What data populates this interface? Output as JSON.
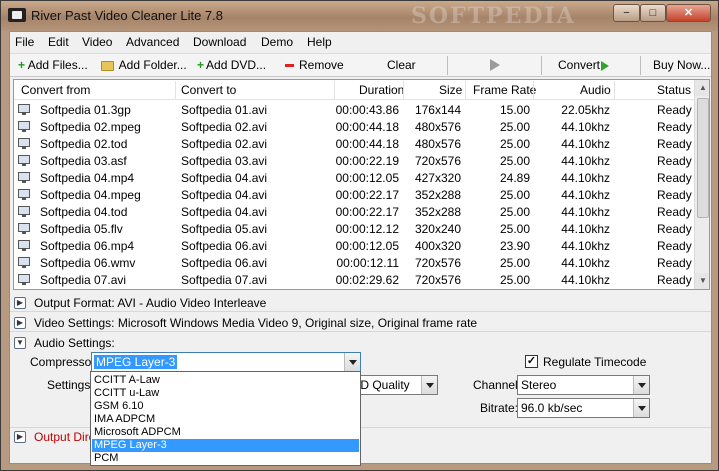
{
  "window": {
    "title": "River Past Video Cleaner Lite 7.8",
    "watermark": "SOFTPEDIA",
    "min": "−",
    "max": "□",
    "close": "✕"
  },
  "menu": [
    "File",
    "Edit",
    "Video",
    "Advanced",
    "Download",
    "Demo",
    "Help"
  ],
  "toolbar": {
    "add_files": "Add Files...",
    "add_folder": "Add Folder...",
    "add_dvd": "Add DVD...",
    "remove": "Remove",
    "clear": "Clear",
    "convert": "Convert",
    "buy_now": "Buy Now..."
  },
  "list": {
    "columns": [
      "Convert from",
      "Convert to",
      "Duration",
      "Size",
      "Frame Rate",
      "Audio",
      "Status"
    ],
    "rows": [
      [
        "Softpedia 01.3gp",
        "Softpedia 01.avi",
        "00:00:43.86",
        "176x144",
        "15.00",
        "22.05khz",
        "Ready"
      ],
      [
        "Softpedia 02.mpeg",
        "Softpedia 02.avi",
        "00:00:44.18",
        "480x576",
        "25.00",
        "44.10khz",
        "Ready"
      ],
      [
        "Softpedia 02.tod",
        "Softpedia 02.avi",
        "00:00:44.18",
        "480x576",
        "25.00",
        "44.10khz",
        "Ready"
      ],
      [
        "Softpedia 03.asf",
        "Softpedia 03.avi",
        "00:00:22.19",
        "720x576",
        "25.00",
        "44.10khz",
        "Ready"
      ],
      [
        "Softpedia 04.mp4",
        "Softpedia 04.avi",
        "00:00:12.05",
        "427x320",
        "24.89",
        "44.10khz",
        "Ready"
      ],
      [
        "Softpedia 04.mpeg",
        "Softpedia 04.avi",
        "00:00:22.17",
        "352x288",
        "25.00",
        "44.10khz",
        "Ready"
      ],
      [
        "Softpedia 04.tod",
        "Softpedia 04.avi",
        "00:00:22.17",
        "352x288",
        "25.00",
        "44.10khz",
        "Ready"
      ],
      [
        "Softpedia 05.flv",
        "Softpedia 05.avi",
        "00:00:12.12",
        "320x240",
        "25.00",
        "44.10khz",
        "Ready"
      ],
      [
        "Softpedia 06.mp4",
        "Softpedia 06.avi",
        "00:00:12.05",
        "400x320",
        "23.90",
        "44.10khz",
        "Ready"
      ],
      [
        "Softpedia 06.wmv",
        "Softpedia 06.avi",
        "00:00:12.11",
        "720x576",
        "25.00",
        "44.10khz",
        "Ready"
      ],
      [
        "Softpedia 07.avi",
        "Softpedia 07.avi",
        "00:02:29.62",
        "720x576",
        "25.00",
        "44.10khz",
        "Ready"
      ]
    ]
  },
  "panels": {
    "output_format": "Output Format: AVI - Audio Video Interleave",
    "video_settings": "Video Settings: Microsoft Windows Media Video 9, Original size, Original frame rate",
    "audio_settings": "Audio Settings:",
    "output_dir": "Output Dire"
  },
  "audio": {
    "compressor_label": "Compressor:",
    "compressor_value": "MPEG Layer-3",
    "settings_label": "Settings:",
    "settings_value": "/D Quality",
    "regulate_label": "Regulate Timecode",
    "regulate_checked": "✓",
    "channel_label": "Channel:",
    "channel_value": "Stereo",
    "bitrate_label": "Bitrate:",
    "bitrate_value": "96.0 kb/sec"
  },
  "dropdown": {
    "items": [
      "CCITT A-Law",
      "CCITT u-Law",
      "GSM 6.10",
      "IMA ADPCM",
      "Microsoft ADPCM",
      "MPEG Layer-3",
      "PCM"
    ],
    "selected": "MPEG Layer-3"
  },
  "colors": {
    "selection": "#3399ff",
    "accent_green": "#1e9b1e",
    "remove_red": "#dd2222"
  }
}
